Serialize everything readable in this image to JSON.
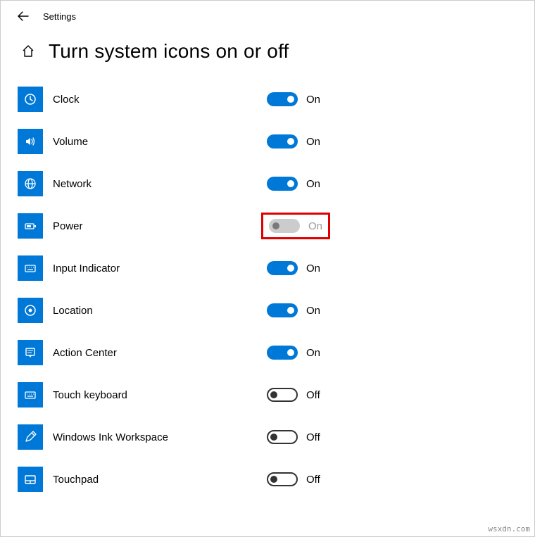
{
  "topbar": {
    "title": "Settings"
  },
  "page": {
    "heading": "Turn system icons on or off"
  },
  "states": {
    "on": "On",
    "off": "Off"
  },
  "items": [
    {
      "key": "clock",
      "label": "Clock",
      "state": "on",
      "highlight": false
    },
    {
      "key": "volume",
      "label": "Volume",
      "state": "on",
      "highlight": false
    },
    {
      "key": "network",
      "label": "Network",
      "state": "on",
      "highlight": false
    },
    {
      "key": "power",
      "label": "Power",
      "state": "disabled",
      "highlight": true
    },
    {
      "key": "input",
      "label": "Input Indicator",
      "state": "on",
      "highlight": false
    },
    {
      "key": "location",
      "label": "Location",
      "state": "on",
      "highlight": false
    },
    {
      "key": "action",
      "label": "Action Center",
      "state": "on",
      "highlight": false
    },
    {
      "key": "touchkb",
      "label": "Touch keyboard",
      "state": "off",
      "highlight": false
    },
    {
      "key": "ink",
      "label": "Windows Ink Workspace",
      "state": "off",
      "highlight": false
    },
    {
      "key": "touchpad",
      "label": "Touchpad",
      "state": "off",
      "highlight": false
    }
  ],
  "watermark": "wsxdn.com"
}
